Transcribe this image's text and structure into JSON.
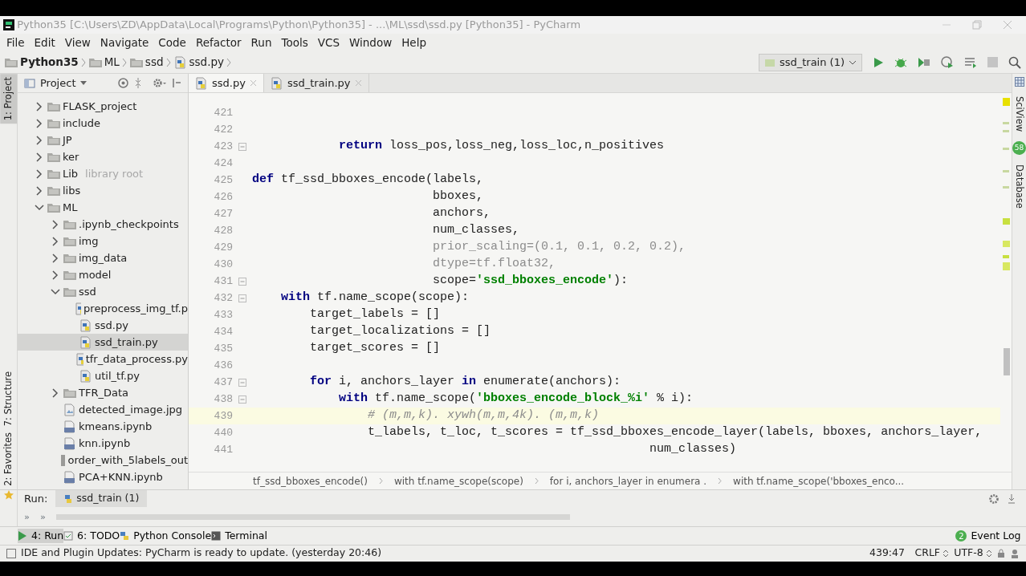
{
  "window": {
    "title": "Python35 [C:\\Users\\ZD\\AppData\\Local\\Programs\\Python\\Python35] - ...\\ML\\ssd\\ssd.py [Python35] - PyCharm"
  },
  "menu": [
    "File",
    "Edit",
    "View",
    "Navigate",
    "Code",
    "Refactor",
    "Run",
    "Tools",
    "VCS",
    "Window",
    "Help"
  ],
  "breadcrumbs": [
    {
      "label": "Python35",
      "kind": "folder",
      "bold": true
    },
    {
      "label": "ML",
      "kind": "folder",
      "bold": false
    },
    {
      "label": "ssd",
      "kind": "folder",
      "bold": false
    },
    {
      "label": "ssd.py",
      "kind": "python",
      "bold": false
    }
  ],
  "run_config": "ssd_train (1)",
  "left_stripe": [
    {
      "label": "1: Project",
      "selected": true
    },
    {
      "label": "7: Structure",
      "selected": false
    },
    {
      "label": "2: Favorites",
      "selected": false
    }
  ],
  "right_stripe": [
    {
      "label": "SciView"
    },
    {
      "label": "Database"
    }
  ],
  "overlay_badge": "58",
  "project_panel": {
    "title": "Project",
    "tree": [
      {
        "label": "FLASK_project",
        "kind": "folder",
        "expanded": false,
        "selected": false
      },
      {
        "label": "include",
        "kind": "folder",
        "expanded": false,
        "selected": false
      },
      {
        "label": "JP",
        "kind": "folder",
        "expanded": false,
        "selected": false
      },
      {
        "label": "ker",
        "kind": "folder",
        "expanded": false,
        "selected": false
      },
      {
        "label": "Lib",
        "note": "library root",
        "kind": "folder",
        "expanded": false,
        "selected": false
      },
      {
        "label": "libs",
        "kind": "folder",
        "expanded": false,
        "selected": false
      },
      {
        "label": "ML",
        "kind": "folder",
        "expanded": true,
        "selected": false,
        "children": [
          {
            "label": ".ipynb_checkpoints",
            "kind": "folder",
            "expanded": false,
            "selected": false
          },
          {
            "label": "img",
            "kind": "folder",
            "expanded": false,
            "selected": false
          },
          {
            "label": "img_data",
            "kind": "folder",
            "expanded": false,
            "selected": false
          },
          {
            "label": "model",
            "kind": "folder",
            "expanded": false,
            "selected": false
          },
          {
            "label": "ssd",
            "kind": "folder",
            "expanded": true,
            "selected": false,
            "children": [
              {
                "label": "preprocess_img_tf.p",
                "kind": "python",
                "selected": false
              },
              {
                "label": "ssd.py",
                "kind": "python",
                "selected": false
              },
              {
                "label": "ssd_train.py",
                "kind": "python",
                "selected": true
              },
              {
                "label": "tfr_data_process.py",
                "kind": "python",
                "selected": false
              },
              {
                "label": "util_tf.py",
                "kind": "python",
                "selected": false
              }
            ]
          },
          {
            "label": "TFR_Data",
            "kind": "folder",
            "expanded": false,
            "selected": false
          },
          {
            "label": "detected_image.jpg",
            "kind": "image",
            "selected": false
          },
          {
            "label": "kmeans.ipynb",
            "kind": "notebook",
            "selected": false
          },
          {
            "label": "knn.ipynb",
            "kind": "notebook",
            "selected": false
          },
          {
            "label": "order_with_5labels_out",
            "kind": "file",
            "selected": false
          },
          {
            "label": "PCA+KNN.ipynb",
            "kind": "notebook",
            "selected": false
          }
        ]
      }
    ]
  },
  "editor_tabs": [
    {
      "label": "ssd.py",
      "selected": true
    },
    {
      "label": "ssd_train.py",
      "selected": false
    }
  ],
  "code_lines": [
    {
      "number": "421",
      "fold": false,
      "current": false
    },
    {
      "number": "422",
      "fold": false,
      "current": false
    },
    {
      "number": "423",
      "fold": true,
      "current": false,
      "segments": [
        {
          "kind": "keyword",
          "text": "            return"
        },
        {
          "kind": "plain",
          "text": " loss_pos,loss_neg,loss_loc,n_positives"
        }
      ]
    },
    {
      "number": "424",
      "fold": false,
      "current": false
    },
    {
      "number": "425",
      "fold": false,
      "current": false,
      "segments": [
        {
          "kind": "keyword",
          "text": "def"
        },
        {
          "kind": "plain",
          "text": " tf_ssd_bboxes_encode(labels,"
        }
      ]
    },
    {
      "number": "426",
      "fold": false,
      "current": false,
      "segments": [
        {
          "kind": "plain",
          "text": "                         bboxes,"
        }
      ]
    },
    {
      "number": "427",
      "fold": false,
      "current": false,
      "segments": [
        {
          "kind": "plain",
          "text": "                         anchors,"
        }
      ]
    },
    {
      "number": "428",
      "fold": false,
      "current": false,
      "segments": [
        {
          "kind": "plain",
          "text": "                         num_classes,"
        }
      ]
    },
    {
      "number": "429",
      "fold": false,
      "current": false,
      "segments": [
        {
          "kind": "dim",
          "text": "                         prior_scaling=(0.1, 0.1, 0.2, 0.2),"
        }
      ]
    },
    {
      "number": "430",
      "fold": false,
      "current": false,
      "segments": [
        {
          "kind": "dim",
          "text": "                         dtype=tf.float32,"
        }
      ]
    },
    {
      "number": "431",
      "fold": true,
      "current": false,
      "segments": [
        {
          "kind": "plain",
          "text": "                         scope="
        },
        {
          "kind": "string",
          "text": "'ssd_bboxes_encode'"
        },
        {
          "kind": "plain",
          "text": "):"
        }
      ]
    },
    {
      "number": "432",
      "fold": true,
      "current": false,
      "segments": [
        {
          "kind": "keyword",
          "text": "    with"
        },
        {
          "kind": "plain",
          "text": " tf.name_scope(scope):"
        }
      ]
    },
    {
      "number": "433",
      "fold": false,
      "current": false,
      "segments": [
        {
          "kind": "plain",
          "text": "        target_labels = []"
        }
      ]
    },
    {
      "number": "434",
      "fold": false,
      "current": false,
      "segments": [
        {
          "kind": "plain",
          "text": "        target_localizations = []"
        }
      ]
    },
    {
      "number": "435",
      "fold": false,
      "current": false,
      "segments": [
        {
          "kind": "plain",
          "text": "        target_scores = []"
        }
      ]
    },
    {
      "number": "436",
      "fold": false,
      "current": false
    },
    {
      "number": "437",
      "fold": true,
      "current": false,
      "segments": [
        {
          "kind": "keyword",
          "text": "        for"
        },
        {
          "kind": "plain",
          "text": " i, anchors_layer "
        },
        {
          "kind": "keyword",
          "text": "in"
        },
        {
          "kind": "plain",
          "text": " enumerate(anchors):"
        }
      ]
    },
    {
      "number": "438",
      "fold": true,
      "current": false,
      "segments": [
        {
          "kind": "keyword",
          "text": "            with"
        },
        {
          "kind": "plain",
          "text": " tf.name_scope("
        },
        {
          "kind": "string",
          "text": "'bboxes_encode_block_%i'"
        },
        {
          "kind": "plain",
          "text": " % i):"
        }
      ]
    },
    {
      "number": "439",
      "fold": false,
      "current": true,
      "segments": [
        {
          "kind": "comment",
          "text": "                # (m,m,k). xywh(m,m,4k). (m,m,k)"
        }
      ]
    },
    {
      "number": "440",
      "fold": false,
      "current": false,
      "segments": [
        {
          "kind": "plain",
          "text": "                t_labels, t_loc, t_scores = tf_ssd_bboxes_encode_layer(labels, bboxes, anchors_layer,"
        }
      ]
    },
    {
      "number": "441",
      "fold": false,
      "current": false,
      "segments": [
        {
          "kind": "plain",
          "text": "                                                       num_classes)"
        }
      ]
    }
  ],
  "editor_breadcrumbs": [
    "tf_ssd_bboxes_encode()",
    "with tf.name_scope(scope)",
    "for i, anchors_layer in enumera .",
    "with tf.name_scope('bboxes_enco..."
  ],
  "run_panel": {
    "label": "Run:",
    "tab": "ssd_train (1)",
    "buttons": [
      "»",
      "»"
    ]
  },
  "tool_windows": [
    {
      "label": "4: Run",
      "kind": "run",
      "selected": true
    },
    {
      "label": "6: TODO",
      "kind": "todo",
      "selected": false
    },
    {
      "label": "Python Console",
      "kind": "console",
      "selected": false
    },
    {
      "label": "Terminal",
      "kind": "terminal",
      "selected": false
    }
  ],
  "event_log": {
    "label": "Event Log",
    "count": "2"
  },
  "status_bar": {
    "message": "IDE and Plugin Updates: PyCharm is ready to update. (yesterday 20:46)",
    "position": "439:47",
    "line_separator": "CRLF",
    "encoding": "UTF-8"
  }
}
